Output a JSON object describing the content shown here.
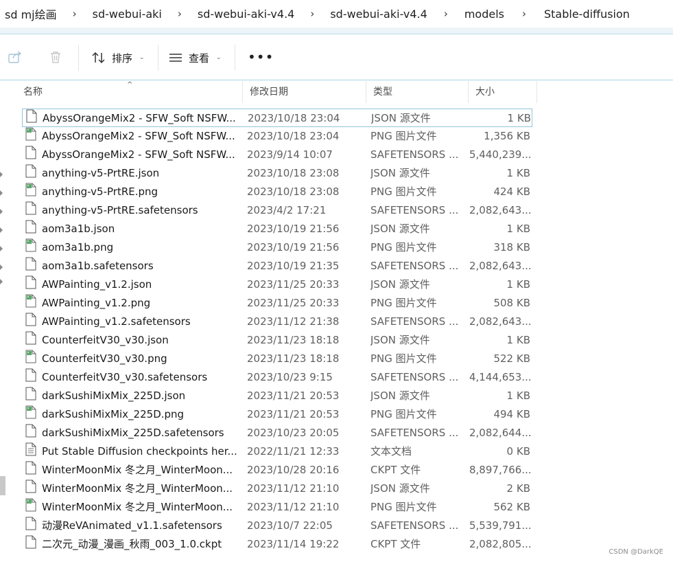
{
  "breadcrumb": [
    "sd mj绘画",
    "sd-webui-aki",
    "sd-webui-aki-v4.4",
    "sd-webui-aki-v4.4",
    "models",
    "Stable-diffusion"
  ],
  "breadcrumb_separator": "›",
  "toolbar": {
    "share_icon": "share-icon",
    "delete_icon": "trash-icon",
    "sort_label": "排序",
    "view_label": "查看",
    "more_label": "•••",
    "chevron": "⌄"
  },
  "columns": {
    "name": "名称",
    "date": "修改日期",
    "type": "类型",
    "size": "大小"
  },
  "files": [
    {
      "name": "AbyssOrangeMix2 - SFW_Soft NSFW...",
      "date": "2023/10/18 23:04",
      "type": "JSON 源文件",
      "size": "1 KB",
      "icon": "json-file-icon",
      "selected": true
    },
    {
      "name": "AbyssOrangeMix2 - SFW_Soft NSFW...",
      "date": "2023/10/18 23:04",
      "type": "PNG 图片文件",
      "size": "1,356 KB",
      "icon": "image-file-icon"
    },
    {
      "name": "AbyssOrangeMix2 - SFW_Soft NSFW...",
      "date": "2023/9/14 10:07",
      "type": "SAFETENSORS ...",
      "size": "5,440,239...",
      "icon": "file-icon"
    },
    {
      "name": "anything-v5-PrtRE.json",
      "date": "2023/10/18 23:08",
      "type": "JSON 源文件",
      "size": "1 KB",
      "icon": "json-file-icon"
    },
    {
      "name": "anything-v5-PrtRE.png",
      "date": "2023/10/18 23:08",
      "type": "PNG 图片文件",
      "size": "424 KB",
      "icon": "image-file-icon"
    },
    {
      "name": "anything-v5-PrtRE.safetensors",
      "date": "2023/4/2 17:21",
      "type": "SAFETENSORS ...",
      "size": "2,082,643...",
      "icon": "file-icon"
    },
    {
      "name": "aom3a1b.json",
      "date": "2023/10/19 21:56",
      "type": "JSON 源文件",
      "size": "1 KB",
      "icon": "json-file-icon"
    },
    {
      "name": "aom3a1b.png",
      "date": "2023/10/19 21:56",
      "type": "PNG 图片文件",
      "size": "318 KB",
      "icon": "image-file-icon"
    },
    {
      "name": "aom3a1b.safetensors",
      "date": "2023/10/19 21:35",
      "type": "SAFETENSORS ...",
      "size": "2,082,643...",
      "icon": "file-icon"
    },
    {
      "name": "AWPainting_v1.2.json",
      "date": "2023/11/25 20:33",
      "type": "JSON 源文件",
      "size": "1 KB",
      "icon": "json-file-icon"
    },
    {
      "name": "AWPainting_v1.2.png",
      "date": "2023/11/25 20:33",
      "type": "PNG 图片文件",
      "size": "508 KB",
      "icon": "image-file-icon"
    },
    {
      "name": "AWPainting_v1.2.safetensors",
      "date": "2023/11/12 21:38",
      "type": "SAFETENSORS ...",
      "size": "2,082,643...",
      "icon": "file-icon"
    },
    {
      "name": "CounterfeitV30_v30.json",
      "date": "2023/11/23 18:18",
      "type": "JSON 源文件",
      "size": "1 KB",
      "icon": "json-file-icon"
    },
    {
      "name": "CounterfeitV30_v30.png",
      "date": "2023/11/23 18:18",
      "type": "PNG 图片文件",
      "size": "522 KB",
      "icon": "image-file-icon"
    },
    {
      "name": "CounterfeitV30_v30.safetensors",
      "date": "2023/10/23 9:15",
      "type": "SAFETENSORS ...",
      "size": "4,144,653...",
      "icon": "file-icon"
    },
    {
      "name": "darkSushiMixMix_225D.json",
      "date": "2023/11/21 20:53",
      "type": "JSON 源文件",
      "size": "1 KB",
      "icon": "json-file-icon"
    },
    {
      "name": "darkSushiMixMix_225D.png",
      "date": "2023/11/21 20:53",
      "type": "PNG 图片文件",
      "size": "494 KB",
      "icon": "image-file-icon"
    },
    {
      "name": "darkSushiMixMix_225D.safetensors",
      "date": "2023/10/23 20:05",
      "type": "SAFETENSORS ...",
      "size": "2,082,644...",
      "icon": "file-icon"
    },
    {
      "name": "Put Stable Diffusion checkpoints her...",
      "date": "2022/11/21 12:33",
      "type": "文本文档",
      "size": "0 KB",
      "icon": "text-file-icon"
    },
    {
      "name": "WinterMoonMix 冬之月_WinterMoon...",
      "date": "2023/10/28 20:16",
      "type": "CKPT 文件",
      "size": "8,897,766...",
      "icon": "file-icon"
    },
    {
      "name": "WinterMoonMix 冬之月_WinterMoon...",
      "date": "2023/11/12 21:10",
      "type": "JSON 源文件",
      "size": "2 KB",
      "icon": "json-file-icon"
    },
    {
      "name": "WinterMoonMix 冬之月_WinterMoon...",
      "date": "2023/11/12 21:10",
      "type": "PNG 图片文件",
      "size": "562 KB",
      "icon": "image-file-icon"
    },
    {
      "name": "动漫ReVAnimated_v1.1.safetensors",
      "date": "2023/10/7 22:05",
      "type": "SAFETENSORS ...",
      "size": "5,539,791...",
      "icon": "file-icon"
    },
    {
      "name": "二次元_动漫_漫画_秋雨_003_1.0.ckpt",
      "date": "2023/11/14 19:22",
      "type": "CKPT 文件",
      "size": "2,082,805...",
      "icon": "file-icon"
    }
  ],
  "watermark": "CSDN @DarkQE",
  "colors": {
    "selection_border": "#93c4dd",
    "toolbar_border": "#a8d6e6",
    "image_icon_green": "#5aa86a"
  }
}
